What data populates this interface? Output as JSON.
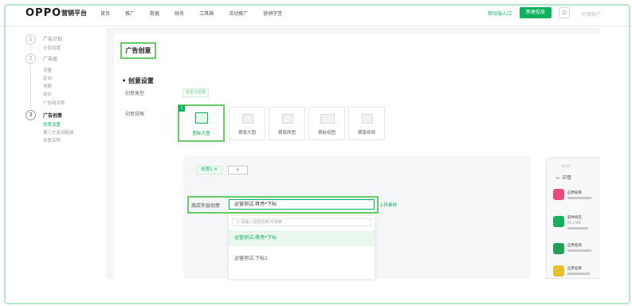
{
  "topbar": {
    "brand": "OPPO",
    "brand_sub": "营销平台",
    "nav": [
      "首页",
      "推广",
      "数据",
      "财务",
      "工具箱",
      "活动推广",
      "营销学堂"
    ],
    "mobile_link": "移动端入口",
    "new_button": "新建投放",
    "icon_label": "⊡",
    "faded_right": "切换账户"
  },
  "sidebar": {
    "step1": {
      "num": "1",
      "title": "广告计划",
      "items": [
        "计划设置"
      ]
    },
    "step2": {
      "num": "2",
      "title": "广告组",
      "items": [
        "流量",
        "定向",
        "排期",
        "出价",
        "广告组名称"
      ]
    },
    "step3": {
      "num": "3",
      "title": "广告创意",
      "items": [
        "创意设置",
        "第三方监测链接",
        "创意名称"
      ]
    }
  },
  "main": {
    "section_heading": "广告创意",
    "sub_heading": "创意设置",
    "creative_type_label": "创意类型",
    "custom_creative": "自定义创意",
    "creative_spec_label": "创意规格",
    "spec_selected_index": 0,
    "specs": [
      "图标大图",
      "横版大图",
      "横版两图",
      "横板组图",
      "横版视频"
    ],
    "creative_tabs": {
      "tab": "创意1 ✕",
      "add": "+"
    },
    "select_label": "商店外层创意",
    "select_value": "运营测试-蒋亮*下标",
    "upload": "上传素材",
    "dropdown": {
      "search_placeholder": "请输入创意名称/ID搜索",
      "options": [
        "运营测试-蒋亮*下标",
        "运营测试-下标1"
      ]
    }
  },
  "phone": {
    "status": "19:47",
    "back": "← 详情",
    "apps": [
      {
        "name": "应用名称",
        "sub": "",
        "color": "#e94b7a"
      },
      {
        "name": "软件商店",
        "sub": "26.2 MB",
        "color": "#16b05c"
      },
      {
        "name": "应用名称",
        "sub": "",
        "color": "#21a05a"
      },
      {
        "name": "应用名称",
        "sub": "",
        "color": "#e8c02e"
      }
    ]
  },
  "colors": {
    "accent": "#0bb15b",
    "highlight": "#66cc66"
  }
}
